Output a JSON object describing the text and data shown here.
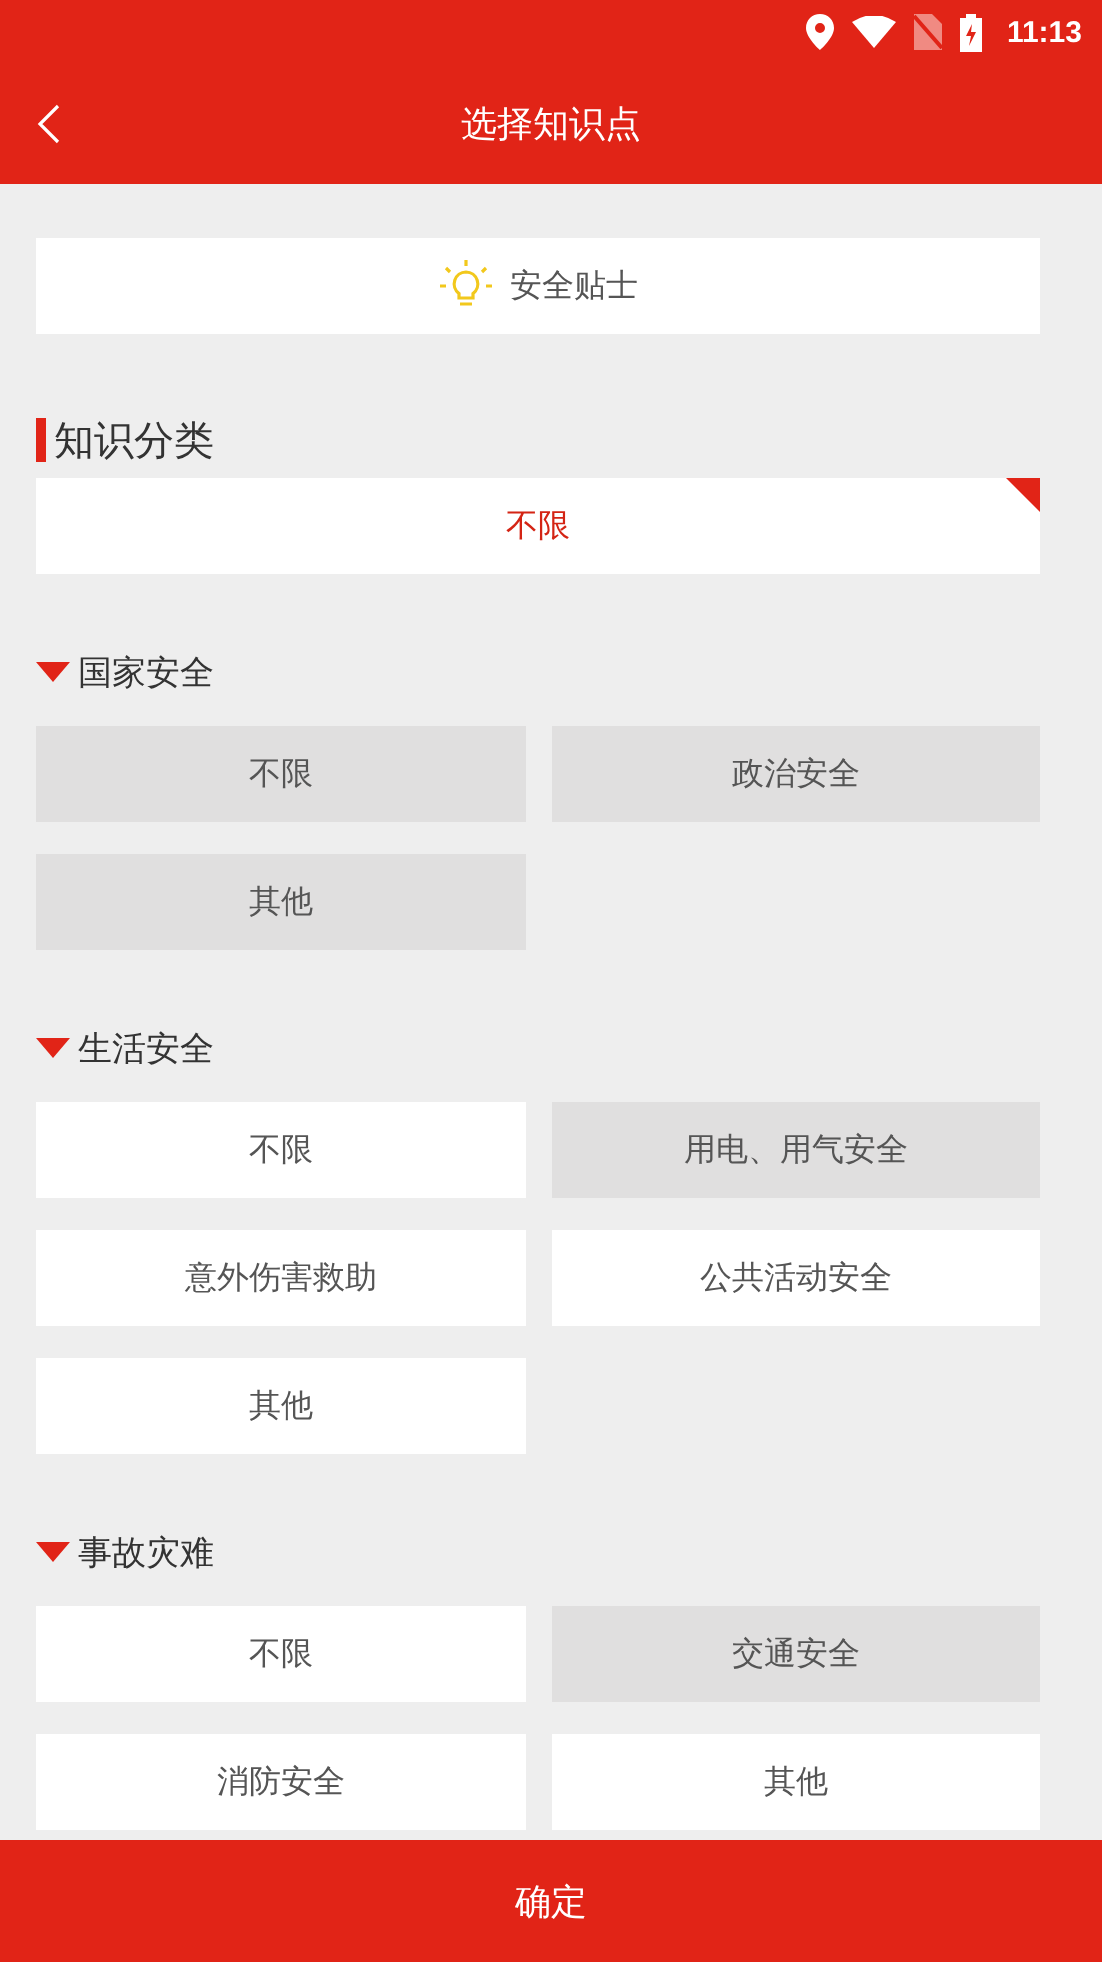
{
  "status_bar": {
    "time": "11:13"
  },
  "header": {
    "title": "选择知识点"
  },
  "tip": {
    "label": "安全贴士"
  },
  "category": {
    "heading": "知识分类",
    "option": {
      "label": "不限",
      "selected": true
    }
  },
  "groups": [
    {
      "title": "国家安全",
      "expanded": true,
      "options": [
        {
          "label": "不限",
          "shaded": true
        },
        {
          "label": "政治安全",
          "shaded": true
        },
        {
          "label": "其他",
          "shaded": true
        }
      ]
    },
    {
      "title": "生活安全",
      "expanded": true,
      "options": [
        {
          "label": "不限",
          "shaded": false
        },
        {
          "label": "用电、用气安全",
          "shaded": true
        },
        {
          "label": "意外伤害救助",
          "shaded": false
        },
        {
          "label": "公共活动安全",
          "shaded": false
        },
        {
          "label": "其他",
          "shaded": false
        }
      ]
    },
    {
      "title": "事故灾难",
      "expanded": true,
      "options": [
        {
          "label": "不限",
          "shaded": false
        },
        {
          "label": "交通安全",
          "shaded": true
        },
        {
          "label": "消防安全",
          "shaded": false
        },
        {
          "label": "其他",
          "shaded": false
        }
      ]
    }
  ],
  "confirm_button": {
    "label": "确定"
  }
}
